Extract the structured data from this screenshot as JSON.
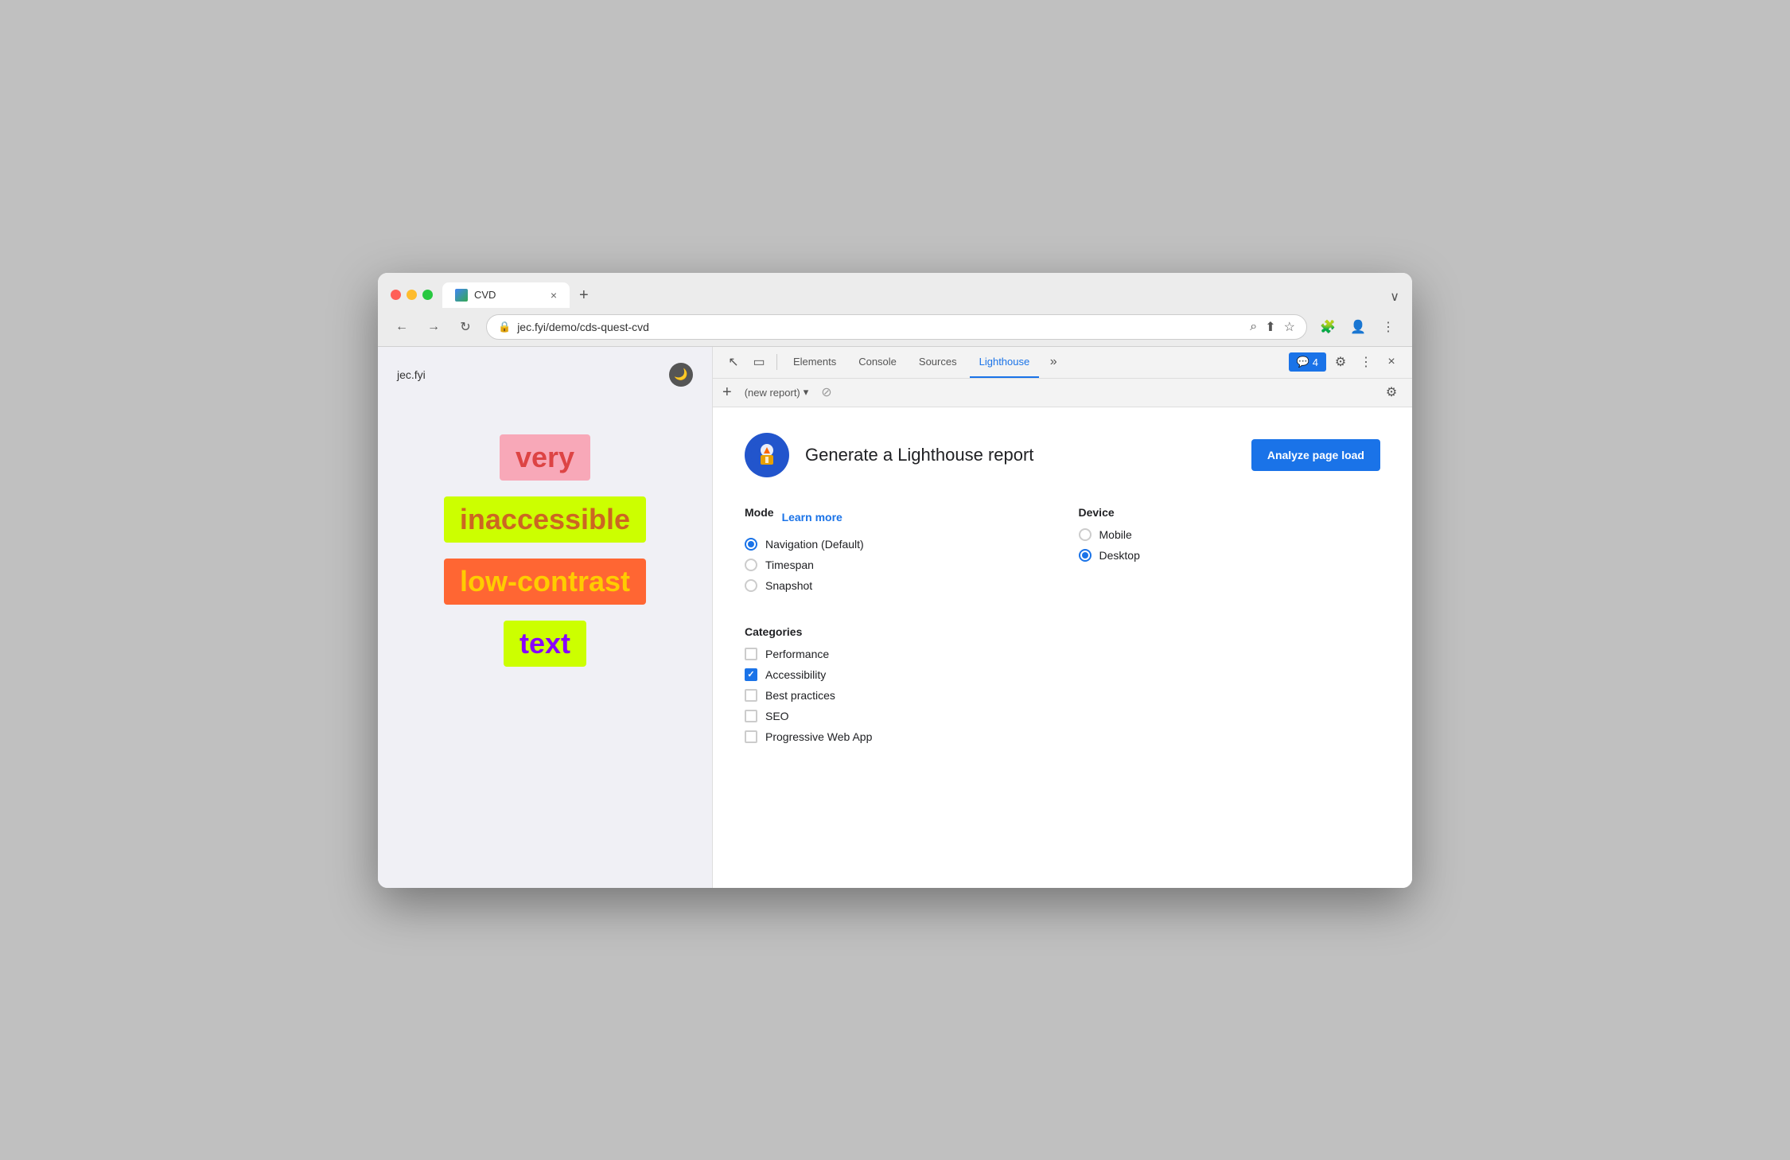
{
  "browser": {
    "tab": {
      "favicon_label": "CVD",
      "title": "CVD",
      "close_label": "×"
    },
    "new_tab_label": "+",
    "chevron_label": "∨",
    "nav": {
      "back_label": "←",
      "forward_label": "→",
      "refresh_label": "↻",
      "lock_icon": "🔒",
      "address": "jec.fyi/demo/cds-quest-cvd"
    },
    "address_icons": {
      "search": "⌕",
      "share": "⬆",
      "bookmark": "☆",
      "extension": "🧩",
      "profile": "👤",
      "menu": "⋮"
    }
  },
  "website": {
    "title": "jec.fyi",
    "dark_mode_icon": "🌙",
    "words": [
      {
        "text": "very",
        "class": "word-very"
      },
      {
        "text": "inaccessible",
        "class": "word-inaccessible"
      },
      {
        "text": "low-contrast",
        "class": "word-low-contrast"
      },
      {
        "text": "text",
        "class": "word-text"
      }
    ]
  },
  "devtools": {
    "topbar": {
      "cursor_icon": "↖",
      "device_icon": "▭",
      "tabs": [
        "Elements",
        "Console",
        "Sources",
        "Lighthouse"
      ],
      "active_tab": "Lighthouse",
      "more_icon": "»",
      "badge_label": "4",
      "badge_icon": "💬",
      "settings_icon": "⚙",
      "more_menu_icon": "⋮",
      "close_icon": "×"
    },
    "secondbar": {
      "add_icon": "+",
      "report_placeholder": "(new report)",
      "dropdown_icon": "▾",
      "block_icon": "⊘",
      "settings_icon": "⚙"
    },
    "lighthouse": {
      "logo_alt": "Lighthouse logo",
      "title": "Generate a Lighthouse report",
      "analyze_btn": "Analyze page load",
      "mode_label": "Mode",
      "learn_more": "Learn more",
      "modes": [
        {
          "label": "Navigation (Default)",
          "selected": true
        },
        {
          "label": "Timespan",
          "selected": false
        },
        {
          "label": "Snapshot",
          "selected": false
        }
      ],
      "device_label": "Device",
      "devices": [
        {
          "label": "Mobile",
          "selected": false
        },
        {
          "label": "Desktop",
          "selected": true
        }
      ],
      "categories_label": "Categories",
      "categories": [
        {
          "label": "Performance",
          "checked": false
        },
        {
          "label": "Accessibility",
          "checked": true
        },
        {
          "label": "Best practices",
          "checked": false
        },
        {
          "label": "SEO",
          "checked": false
        },
        {
          "label": "Progressive Web App",
          "checked": false
        }
      ]
    }
  }
}
